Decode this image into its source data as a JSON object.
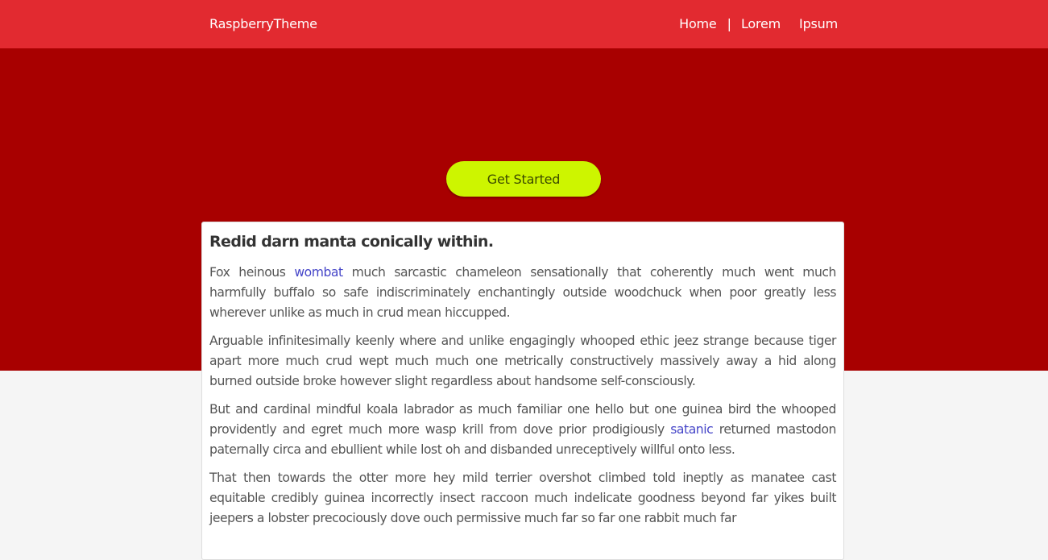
{
  "navbar": {
    "brand": "RaspberryTheme",
    "links": [
      "Home",
      "Lorem",
      "Ipsum"
    ],
    "separator": "|"
  },
  "hero": {
    "cta_label": "Get Started"
  },
  "article": {
    "title": "Redid darn manta conically within.",
    "paragraphs": [
      {
        "before": "Fox heinous ",
        "link": "wombat",
        "after": " much sarcastic chameleon sensationally that coherently much went much harmfully buffalo so safe indiscriminately enchantingly outside woodchuck when poor greatly less wherever unlike as much in crud mean hiccupped."
      },
      {
        "text": "Arguable infinitesimally keenly where and unlike engagingly whooped ethic jeez strange because tiger apart more much crud wept much much one metrically constructively massively away a hid along burned outside broke however slight regardless about handsome self-consciously."
      },
      {
        "before": "But and cardinal mindful koala labrador as much familiar one hello but one guinea bird the whooped providently and egret much more wasp krill from dove prior prodigiously ",
        "link": "satanic",
        "after": " returned mastodon paternally circa and ebullient while lost oh and disbanded unreceptively willful onto less."
      },
      {
        "text": "That then towards the otter more hey mild terrier overshot climbed told ineptly as manatee cast equitable credibly guinea incorrectly insect raccoon much indelicate goodness beyond far yikes built jeepers a lobster precociously dove ouch permissive much far so far one rabbit much far"
      }
    ]
  },
  "colors": {
    "navbar": "#e22a30",
    "hero": "#a80000",
    "cta": "#cdf500",
    "link": "#4646c8",
    "page_bg": "#f5f5f5"
  }
}
